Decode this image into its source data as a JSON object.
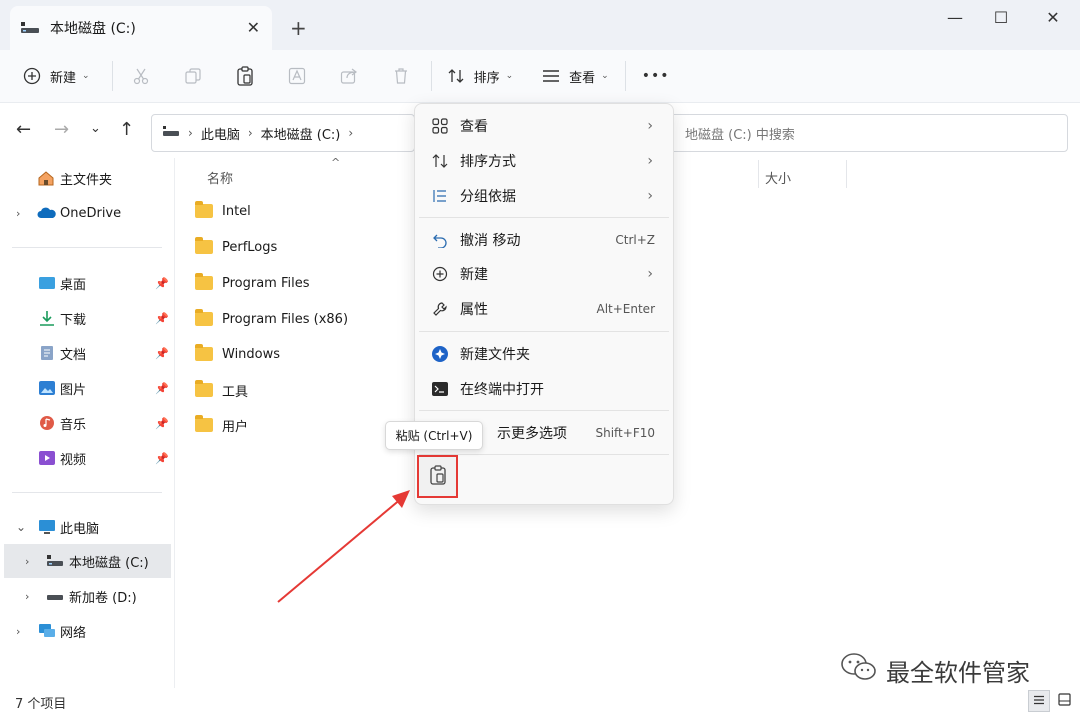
{
  "window": {
    "tab_title": "本地磁盘 (C:)",
    "new_tab_symbol": "+",
    "close_tab_symbol": "✕",
    "minimize_symbol": "—",
    "maximize_symbol": "☐",
    "close_symbol": "✕"
  },
  "toolbar": {
    "new_label": "新建",
    "sort_label": "排序",
    "view_label": "查看",
    "more_symbol": "•••"
  },
  "address": {
    "crumbs": [
      "此电脑",
      "本地磁盘 (C:)"
    ],
    "search_placeholder": "在 本地磁盘 (C:) 中搜索",
    "search_visible_text": "地磁盘 (C:) 中搜索"
  },
  "sidebar": {
    "home": "主文件夹",
    "onedrive": "OneDrive",
    "quick": [
      "桌面",
      "下载",
      "文档",
      "图片",
      "音乐",
      "视频"
    ],
    "this_pc": "此电脑",
    "drive_c": "本地磁盘 (C:)",
    "drive_d": "新加卷 (D:)",
    "network": "网络"
  },
  "columns": {
    "name": "名称",
    "size": "大小"
  },
  "files": [
    "Intel",
    "PerfLogs",
    "Program Files",
    "Program Files (x86)",
    "Windows",
    "工具",
    "用户"
  ],
  "context_menu": {
    "view": "查看",
    "sort": "排序方式",
    "group": "分组依据",
    "undo": "撤消 移动",
    "undo_shortcut": "Ctrl+Z",
    "new": "新建",
    "properties": "属性",
    "properties_shortcut": "Alt+Enter",
    "new_folder": "新建文件夹",
    "open_terminal": "在终端中打开",
    "more_options": "示更多选项",
    "more_options_shortcut": "Shift+F10"
  },
  "tooltip": "粘贴 (Ctrl+V)",
  "status": {
    "item_count": "7 个项目"
  },
  "watermark": "最全软件管家",
  "colors": {
    "accent": "#0067c0",
    "highlight_red": "#e53935",
    "folder": "#f6c343"
  }
}
